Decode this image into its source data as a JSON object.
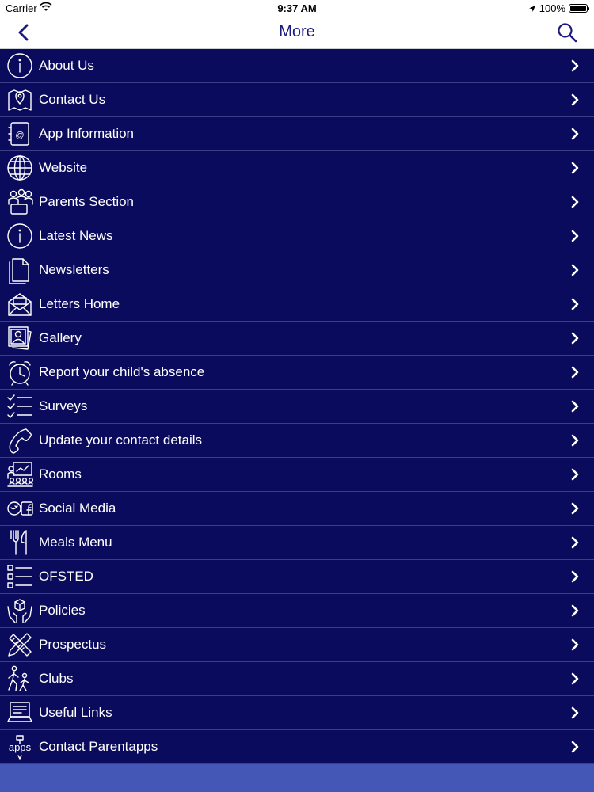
{
  "status_bar": {
    "carrier": "Carrier",
    "time": "9:37 AM",
    "battery": "100%",
    "battery_level": 1.0
  },
  "nav": {
    "title": "More",
    "back_icon": "chevron-left-icon",
    "search_icon": "search-icon"
  },
  "colors": {
    "background": "#0b0b5e",
    "accent": "#1a1a80",
    "bottom_bar": "#4457b6"
  },
  "menu": {
    "items": [
      {
        "label": "About Us",
        "icon": "info-icon"
      },
      {
        "label": "Contact Us",
        "icon": "map-pin-icon"
      },
      {
        "label": "App Information",
        "icon": "address-book-icon"
      },
      {
        "label": "Website",
        "icon": "globe-icon"
      },
      {
        "label": "Parents Section",
        "icon": "people-icon"
      },
      {
        "label": "Latest News",
        "icon": "info-icon"
      },
      {
        "label": "Newsletters",
        "icon": "document-icon"
      },
      {
        "label": "Letters Home",
        "icon": "envelope-icon"
      },
      {
        "label": "Gallery",
        "icon": "photos-icon"
      },
      {
        "label": "Report your child's absence",
        "icon": "alarm-clock-icon"
      },
      {
        "label": "Surveys",
        "icon": "checklist-icon"
      },
      {
        "label": "Update your contact details",
        "icon": "phone-icon"
      },
      {
        "label": "Rooms",
        "icon": "classroom-icon"
      },
      {
        "label": "Social Media",
        "icon": "social-icon"
      },
      {
        "label": "Meals Menu",
        "icon": "cutlery-icon"
      },
      {
        "label": "OFSTED",
        "icon": "checkbox-list-icon"
      },
      {
        "label": "Policies",
        "icon": "hands-box-icon"
      },
      {
        "label": "Prospectus",
        "icon": "pencil-ruler-icon"
      },
      {
        "label": "Clubs",
        "icon": "walking-people-icon"
      },
      {
        "label": "Useful Links",
        "icon": "laptop-icon"
      },
      {
        "label": "Contact Parentapps",
        "icon": "apps-icon"
      }
    ]
  }
}
